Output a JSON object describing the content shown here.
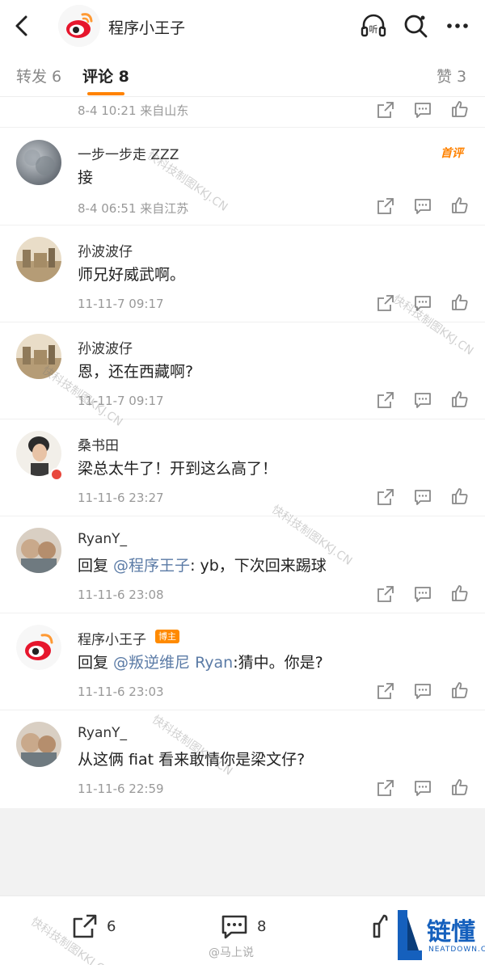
{
  "header": {
    "title": "程序小王子",
    "icons": [
      "back-arrow-icon",
      "weibo-logo",
      "listen-icon",
      "search-icon",
      "more-icon"
    ],
    "listen_label": "听"
  },
  "tabs": [
    {
      "label": "转发 6"
    },
    {
      "label": "评论 8"
    },
    {
      "label": "赞 3"
    }
  ],
  "first_meta": "8-4 10:21 来自山东",
  "comments": [
    {
      "name": "一步一步走 ZZZ",
      "text": "接",
      "meta": "8-4 06:51 来自江苏",
      "badge": "首评"
    },
    {
      "name": "孙波波仔",
      "text": "师兄好威武啊。",
      "meta": "11-11-7 09:17"
    },
    {
      "name": "孙波波仔",
      "text": "恩，还在西藏啊?",
      "meta": "11-11-7 09:17"
    },
    {
      "name": "桑书田",
      "text": "梁总太牛了！开到这么高了！",
      "meta": "11-11-6 23:27"
    },
    {
      "name": "RyanY_",
      "text_prefix": "回复 ",
      "mention": "@程序王子",
      "text_suffix": ": yb，下次回来踢球",
      "meta": "11-11-6 23:08"
    },
    {
      "name": "程序小王子",
      "badge": "博主",
      "text_prefix": "回复 ",
      "mention": "@叛逆维尼 Ryan",
      "text_suffix": ":猜中。你是?",
      "meta": "11-11-6 23:03"
    },
    {
      "name": "RyanY_",
      "text": "从这俩 fiat 看来敢情你是梁文仔?",
      "meta": "11-11-6 22:59"
    }
  ],
  "bottom": {
    "repost_count": "6",
    "comment_count": "8"
  },
  "watermarks": {
    "text": "快科技制图KKJ.CN",
    "footer": "@马上说"
  },
  "brand": {
    "name": "链懂",
    "site": "NEATDOWN.COM"
  },
  "colors": {
    "accent": "#ff8200",
    "mention": "#5b7ba6",
    "brand": "#1560bd"
  }
}
